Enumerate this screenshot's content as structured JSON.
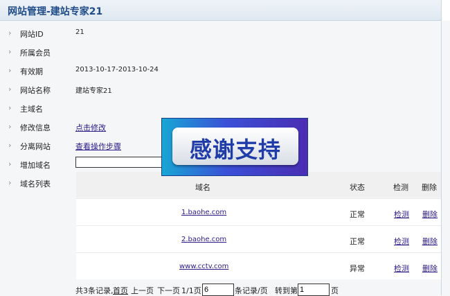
{
  "title": "网站管理-建站专家21",
  "fields": {
    "site_id": {
      "label": "网站ID",
      "value": "21"
    },
    "member": {
      "label": "所属会员",
      "value": ""
    },
    "validity": {
      "label": "有效期",
      "value": "2013-10-17-2013-10-24"
    },
    "site_name": {
      "label": "网站名称",
      "value": "建站专家21"
    },
    "main_domain": {
      "label": "主域名",
      "value": ""
    },
    "modify": {
      "label": "修改信息",
      "link": "点击修改"
    },
    "detach": {
      "label": "分离网站",
      "link": "查看操作步骤"
    },
    "add_domain": {
      "label": "增加域名",
      "value": ""
    },
    "domain_list": {
      "label": "域名列表"
    }
  },
  "table": {
    "headers": {
      "domain": "域名",
      "status": "状态",
      "check": "检测",
      "delete": "删除"
    },
    "rows": [
      {
        "domain": "1.baohe.com",
        "status": "正常",
        "check": "检测",
        "delete": "删除"
      },
      {
        "domain": "2.baohe.com",
        "status": "正常",
        "check": "检测",
        "delete": "删除"
      },
      {
        "domain": "www.cctv.com",
        "status": "异常",
        "check": "检测",
        "delete": "删除"
      }
    ]
  },
  "pagination": {
    "total": "共3条记录,",
    "first": "首页",
    "prev": "上一页",
    "next": "下一页",
    "page_info": "1/1页",
    "per_page_value": "6",
    "per_page_suffix": "条记录/页",
    "goto_label": "转到第",
    "goto_value": "1",
    "goto_suffix": "页"
  },
  "banner": {
    "text": "感谢支持"
  }
}
